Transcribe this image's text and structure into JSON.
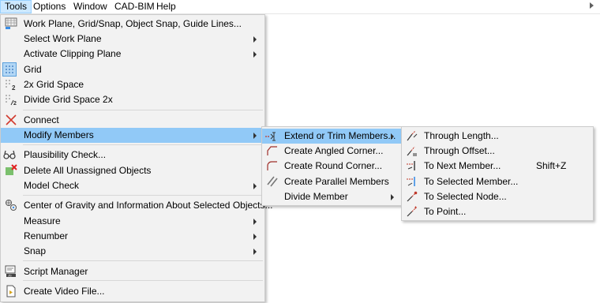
{
  "menubar": {
    "items": [
      "Tools",
      "Options",
      "Window",
      "CAD-BIM",
      "Help"
    ]
  },
  "tools_menu": {
    "items": [
      {
        "label": "Work Plane, Grid/Snap, Object Snap, Guide Lines...",
        "icon": "work-plane-icon"
      },
      {
        "label": "Select Work Plane",
        "icon": null
      },
      {
        "label": "Activate Clipping Plane",
        "icon": null
      },
      {
        "label": "Grid",
        "icon": "grid-icon",
        "checked": true
      },
      {
        "label": "2x Grid Space",
        "icon": "grid-double-icon"
      },
      {
        "label": "Divide Grid Space 2x",
        "icon": "grid-divide-icon"
      },
      {
        "label": "Connect",
        "icon": "connect-icon"
      },
      {
        "label": "Modify Members",
        "icon": null
      },
      {
        "label": "Plausibility Check...",
        "icon": "plausibility-check-icon"
      },
      {
        "label": "Delete All Unassigned Objects",
        "icon": "delete-unassigned-icon"
      },
      {
        "label": "Model Check",
        "icon": null
      },
      {
        "label": "Center of Gravity and Information About Selected Objects...",
        "icon": "center-of-gravity-icon"
      },
      {
        "label": "Measure",
        "icon": null
      },
      {
        "label": "Renumber",
        "icon": null
      },
      {
        "label": "Snap",
        "icon": null
      },
      {
        "label": "Script Manager",
        "icon": "script-manager-icon"
      },
      {
        "label": "Create Video File...",
        "icon": "video-file-icon"
      }
    ]
  },
  "modify_members_menu": {
    "items": [
      {
        "label": "Extend or Trim Members...",
        "icon": "extend-trim-icon"
      },
      {
        "label": "Create Angled Corner...",
        "icon": "angled-corner-icon"
      },
      {
        "label": "Create Round Corner...",
        "icon": "round-corner-icon"
      },
      {
        "label": "Create Parallel Members",
        "icon": "parallel-members-icon"
      },
      {
        "label": "Divide Member",
        "icon": null
      }
    ]
  },
  "extend_trim_menu": {
    "items": [
      {
        "label": "Through Length...",
        "icon": "through-length-icon"
      },
      {
        "label": "Through Offset...",
        "icon": "through-offset-icon"
      },
      {
        "label": "To Next Member...",
        "icon": "to-next-member-icon",
        "shortcut": "Shift+Z"
      },
      {
        "label": "To Selected Member...",
        "icon": "to-selected-member-icon"
      },
      {
        "label": "To Selected Node...",
        "icon": "to-selected-node-icon"
      },
      {
        "label": "To Point...",
        "icon": "to-point-icon"
      }
    ]
  },
  "colors": {
    "highlight": "#91c9f7",
    "menu_bg": "#f2f2f2",
    "menubar_active": "#cce8ff"
  }
}
